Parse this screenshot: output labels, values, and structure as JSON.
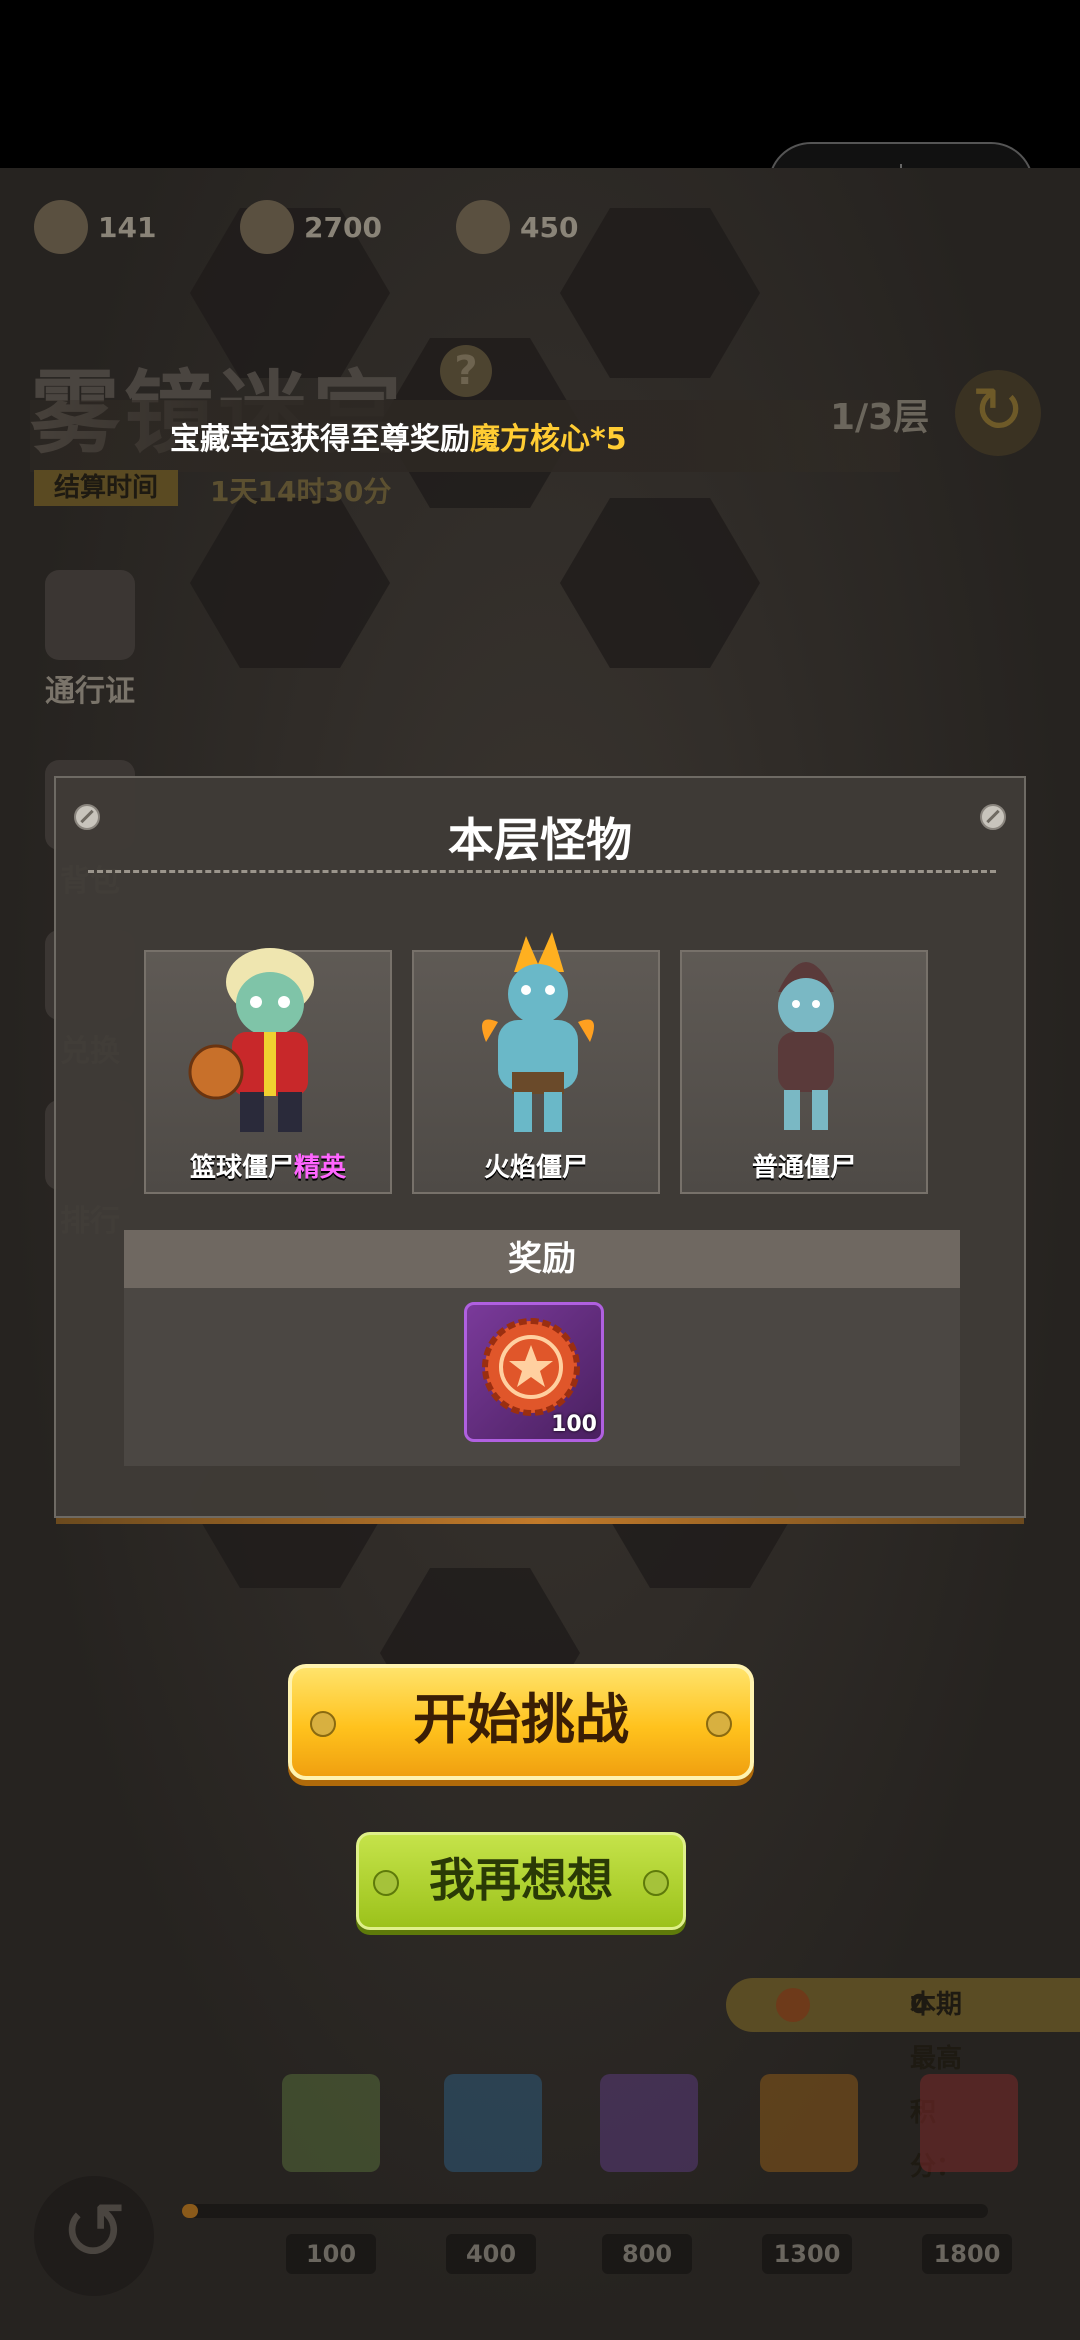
{
  "resources": [
    {
      "icon": "gem-plus-icon",
      "value": "141"
    },
    {
      "icon": "compass-coin-icon",
      "value": "2700"
    },
    {
      "icon": "ticket-icon",
      "value": "450"
    }
  ],
  "header": {
    "title": "雾镜迷宫",
    "help": "?",
    "floor": "1/3层",
    "settle_label": "结算时间",
    "settle_time": "1天14时30分"
  },
  "marquee": {
    "prefix": "宝藏幸运获得至尊奖励",
    "highlight": "魔方核心*5"
  },
  "side_menu": [
    "通行证",
    "背包",
    "兑换",
    "排行"
  ],
  "modal": {
    "title": "本层怪物",
    "monsters": [
      {
        "name": "篮球僵尸",
        "tag": "精英"
      },
      {
        "name": "火焰僵尸",
        "tag": ""
      },
      {
        "name": "普通僵尸",
        "tag": ""
      }
    ],
    "reward_title": "奖励",
    "reward_count": "100"
  },
  "buttons": {
    "start": "开始挑战",
    "rethink": "我再想想"
  },
  "score": {
    "label": "本期最高积分：",
    "value": "0"
  },
  "milestones": [
    "100",
    "400",
    "800",
    "1300",
    "1800"
  ],
  "progress": 0.0,
  "colors": {
    "start_button": "#ffc21d",
    "rethink_button": "#9cc21b",
    "elite_tag": "#ff66ff",
    "highlight": "#ffcc33"
  }
}
